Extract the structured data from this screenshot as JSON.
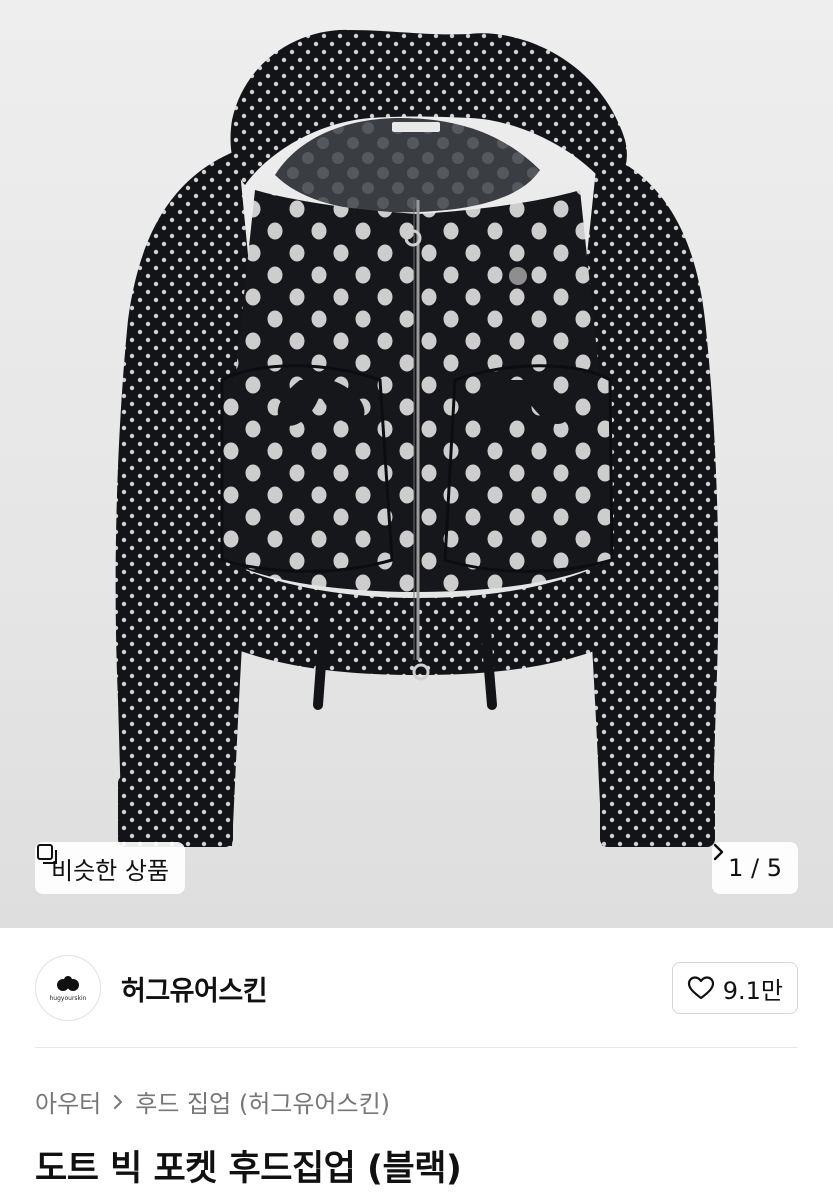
{
  "image": {
    "alt_subject": "jacket",
    "similar_button": {
      "label": "비슷한 상품",
      "icon": "similar-items-icon"
    },
    "pager": {
      "text": "1 / 5",
      "current": 1,
      "total": 5,
      "icon": "chevron-right-icon"
    }
  },
  "brand": {
    "name": "허그유어스킨",
    "logo_text": "hugyourskin",
    "like_count": "9.1만",
    "like_icon": "heart-outline-icon"
  },
  "breadcrumb": {
    "items": [
      "아우터",
      "후드 집업 (허그유어스킨)"
    ]
  },
  "product": {
    "title": "도트 빅 포켓 후드집업 (블랙)"
  },
  "colors": {
    "garment": "#121418",
    "dot": "#cfcfcf"
  }
}
